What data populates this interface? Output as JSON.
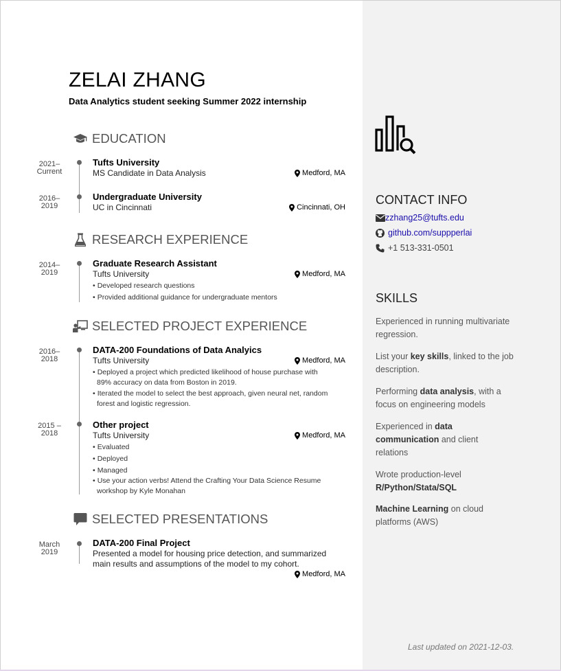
{
  "header": {
    "name": "ZELAI ZHANG",
    "tagline": "Data Analytics student seeking Summer 2022 internship"
  },
  "education": {
    "title": "EDUCATION",
    "icon": "graduation-cap-icon",
    "entries": [
      {
        "date_1": "2021–",
        "date_2": "Current",
        "title": "Tufts University",
        "subtitle": "MS Candidate in Data Analysis",
        "location": "Medford, MA"
      },
      {
        "date_1": "2016–",
        "date_2": "2019",
        "title": "Undergraduate University",
        "subtitle": "UC in Cincinnati",
        "location": "Cincinnati, OH"
      }
    ]
  },
  "research": {
    "title": "RESEARCH EXPERIENCE",
    "icon": "flask-icon",
    "entries": [
      {
        "date_1": "2014–",
        "date_2": "2019",
        "title": "Graduate Research Assistant",
        "subtitle": "Tufts University",
        "location": "Medford, MA",
        "bullets": [
          "Developed research questions",
          "Provided additional guidance for undergraduate mentors"
        ]
      }
    ]
  },
  "projects": {
    "title": "SELECTED PROJECT EXPERIENCE",
    "icon": "chalkboard-teacher-icon",
    "entries": [
      {
        "date_1": "2016–",
        "date_2": "2018",
        "title": "DATA-200 Foundations of Data Analyics",
        "subtitle": "Tufts University",
        "location": "Medford, MA",
        "bullets": [
          {
            "line1": "Deployed a project which predicted likelihood of house purchase with",
            "line2": "89% accuracy on data from Boston in 2019."
          },
          {
            "line1": "Iterated the model to select the best approach, given neural net, random",
            "line2": "forest and logistic regression."
          }
        ]
      },
      {
        "date_1": "2015 –",
        "date_2": "2018",
        "title": "Other project",
        "subtitle": "Tufts University",
        "location": "Medford, MA",
        "bullets": [
          "Evaluated",
          "Deployed",
          "Managed"
        ],
        "last_bullet": {
          "line1": "Use your action verbs! Attend the Crafting Your Data Science Resume",
          "line2": "workshop by Kyle Monahan"
        }
      }
    ]
  },
  "presentations": {
    "title": "SELECTED PRESENTATIONS",
    "icon": "comment-icon",
    "entries": [
      {
        "date_1": "March",
        "date_2": "2019",
        "title": "DATA-200 Final Project",
        "desc_1": "Presented a model for housing price detection, and summarized",
        "desc_2": "main results and assumptions of the model to my cohort.",
        "location": "Medford, MA"
      }
    ]
  },
  "aside": {
    "logo_icon": "bar-chart-magnifier-icon",
    "contact_title": "CONTACT INFO",
    "email": "zzhang25@tufts.edu",
    "github": "github.com/suppperlai",
    "phone": "+1 513-331-0501",
    "skills_title": "SKILLS",
    "skills": [
      {
        "pre": "Experienced in running multivariate regression.",
        "bold": "",
        "post": ""
      },
      {
        "pre": "List your ",
        "bold": "key skills",
        "post": ", linked to the job description."
      },
      {
        "pre": "Performing ",
        "bold": "data analysis",
        "post": ", with a focus on engineering models"
      },
      {
        "pre": "Experienced in ",
        "bold": "data communication",
        "post": " and client relations"
      },
      {
        "pre": "Wrote production-level ",
        "bold": "R/Python/Stata/SQL",
        "post": ""
      },
      {
        "pre": "",
        "bold": "Machine Learning",
        "post": " on cloud platforms (AWS)"
      }
    ],
    "updated": "Last updated on 2021-12-03.",
    "colors": {
      "sidebar_bg": "#f2f2f2",
      "link": "#1a0dab"
    }
  }
}
